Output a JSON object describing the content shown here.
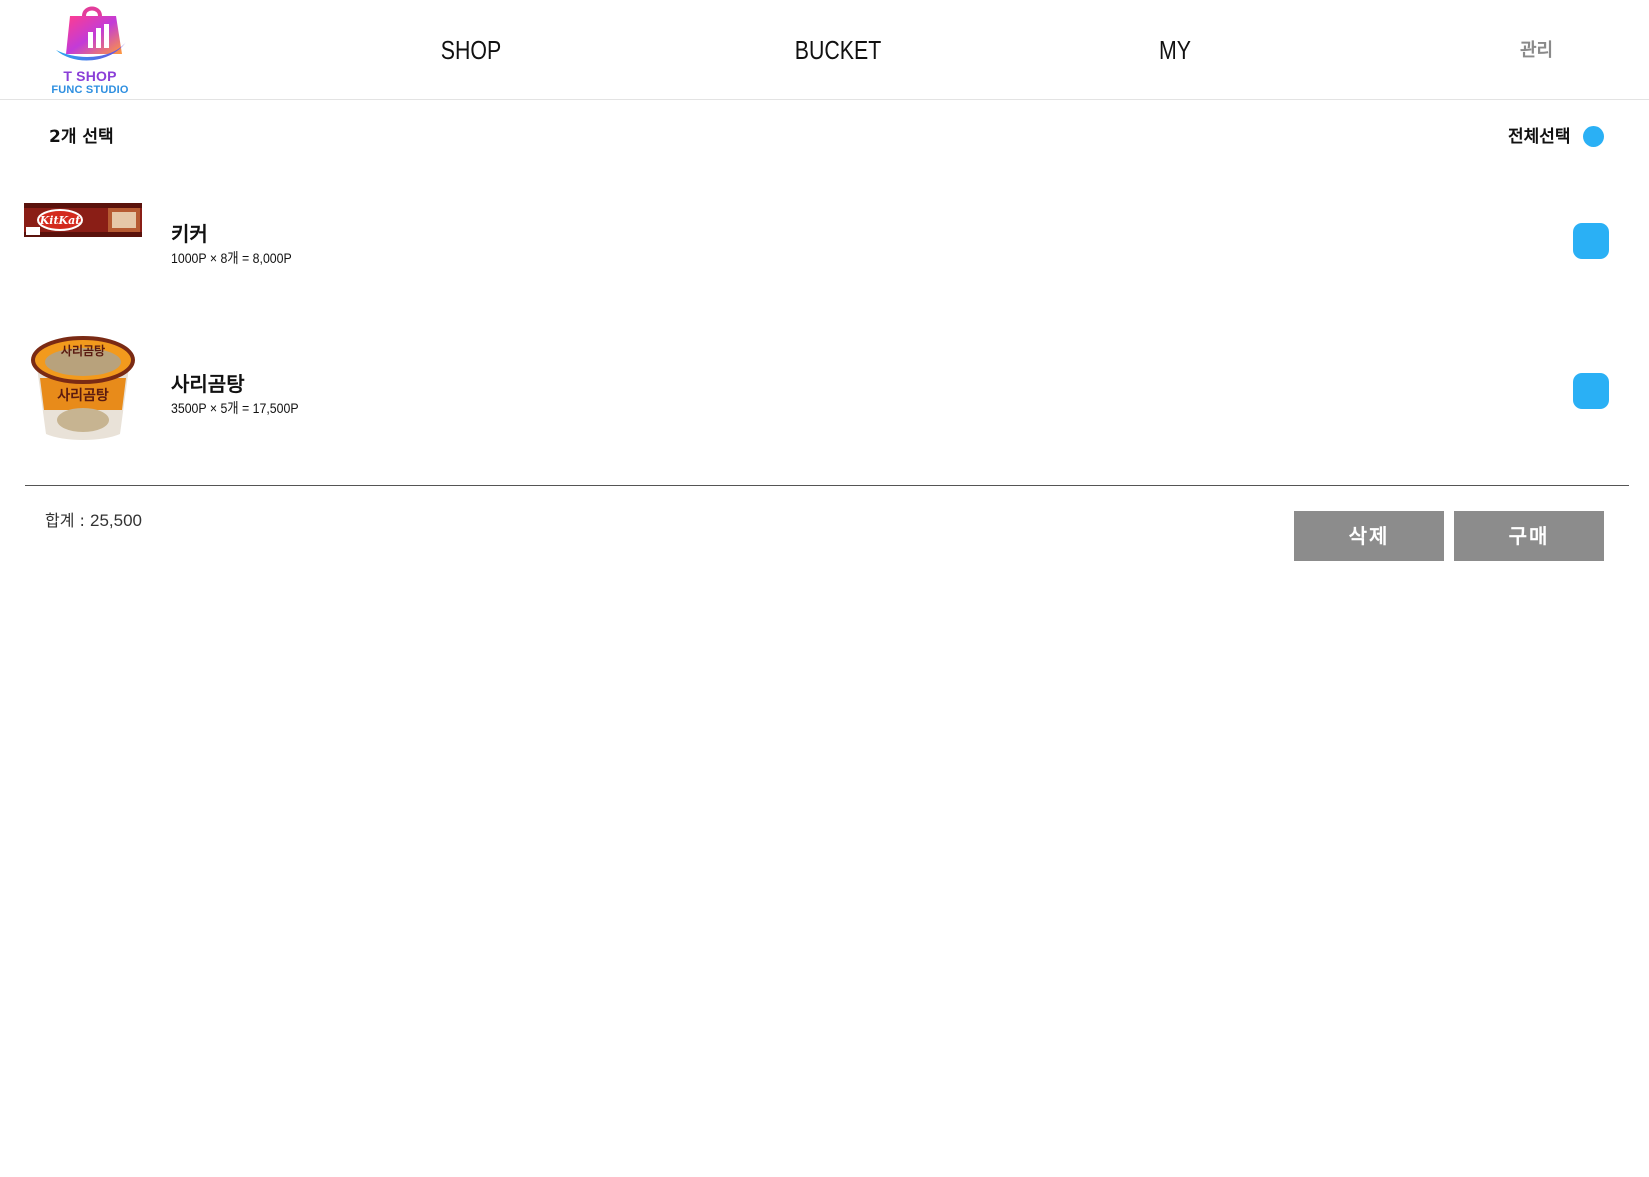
{
  "header": {
    "logo_line1": "T SHOP",
    "logo_line2": "FUNC STUDIO",
    "nav": [
      {
        "label": "SHOP"
      },
      {
        "label": "BUCKET"
      },
      {
        "label": "MY"
      }
    ],
    "admin_label": "관리"
  },
  "selection": {
    "count_label": "2개 선택",
    "select_all_label": "전체선택"
  },
  "items": [
    {
      "name": "키커",
      "price_line": "1000P × 8개 = 8,000P",
      "image": "kitkat-wafer-bar",
      "checked": true
    },
    {
      "name": "사리곰탕",
      "price_line": "3500P × 5개 = 17,500P",
      "image": "sarigomtang-cup-noodle",
      "checked": true
    }
  ],
  "footer": {
    "total_label": "합계 : ",
    "total_value": "25,500",
    "delete_label": "삭제",
    "buy_label": "구매"
  },
  "colors": {
    "accent": "#2ab0f5",
    "button_gray": "#8c8c8c",
    "nav_admin": "#8a8a8a"
  }
}
